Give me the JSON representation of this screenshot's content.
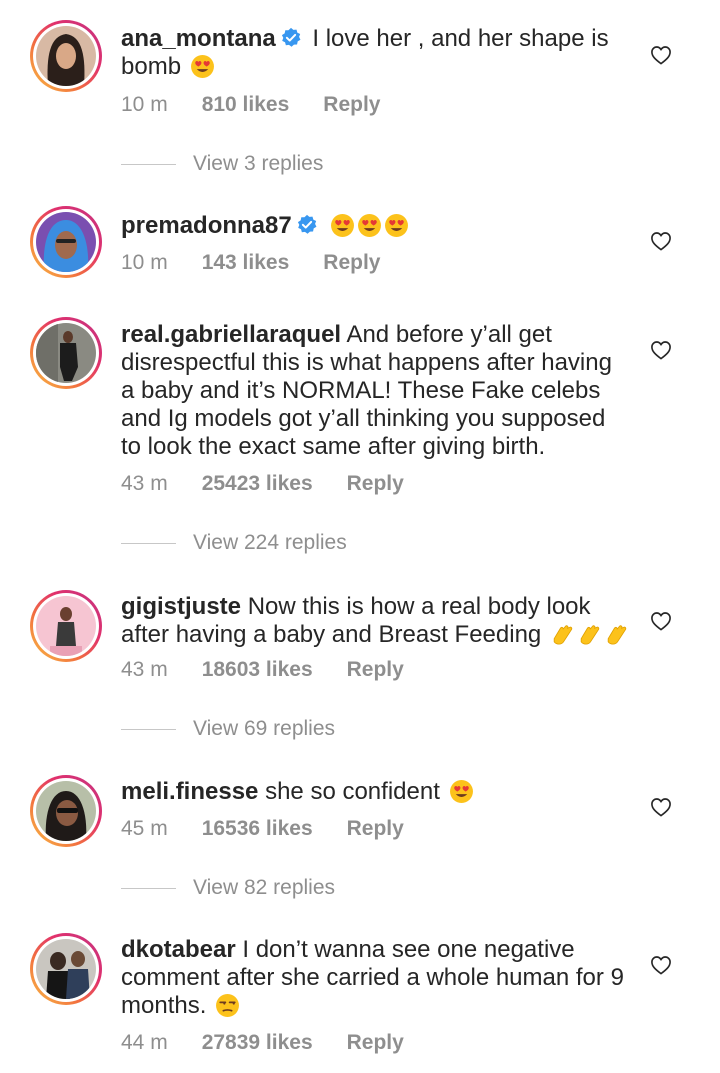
{
  "comments": [
    {
      "username": "ana_montana",
      "verified": true,
      "text": "I love her , and her shape is bomb",
      "emoji": "heart-eyes",
      "time": "10 m",
      "likes": "810 likes",
      "reply_label": "Reply",
      "view_replies": "View 3 replies"
    },
    {
      "username": "premadonna87",
      "verified": true,
      "text": "",
      "emoji": "heart-eyes x3",
      "time": "10 m",
      "likes": "143 likes",
      "reply_label": "Reply"
    },
    {
      "username": "real.gabriellaraquel",
      "verified": false,
      "text": "And before y’all get disrespectful this is what happens after having a baby and it’s NORMAL! These Fake celebs and Ig models got y’all thinking you supposed to look the exact same after giving birth.",
      "time": "43 m",
      "likes": "25423 likes",
      "reply_label": "Reply",
      "view_replies": "View 224 replies"
    },
    {
      "username": "gigistjuste",
      "verified": false,
      "text": "Now this is how a real body look after having a baby and Breast Feeding",
      "emoji": "clapping-hands x3",
      "time": "43 m",
      "likes": "18603 likes",
      "reply_label": "Reply",
      "view_replies": "View 69 replies"
    },
    {
      "username": "meli.finesse",
      "verified": false,
      "text": "she so confident",
      "emoji": "heart-eyes",
      "time": "45 m",
      "likes": "16536 likes",
      "reply_label": "Reply",
      "view_replies": "View 82 replies"
    },
    {
      "username": "dkotabear",
      "verified": false,
      "text": "I don’t wanna see one negative comment after she carried a whole human for 9 months.",
      "emoji": "unamused-face",
      "time": "44 m",
      "likes": "27839 likes",
      "reply_label": "Reply"
    }
  ],
  "colors": {
    "text": "#262626",
    "meta": "#8e8e8e",
    "verified": "#3897f0",
    "story_ring": [
      "#f9c045",
      "#e1306c",
      "#c13584"
    ]
  },
  "icons": {
    "verified": "verified-badge-icon",
    "like": "heart-outline-icon"
  }
}
